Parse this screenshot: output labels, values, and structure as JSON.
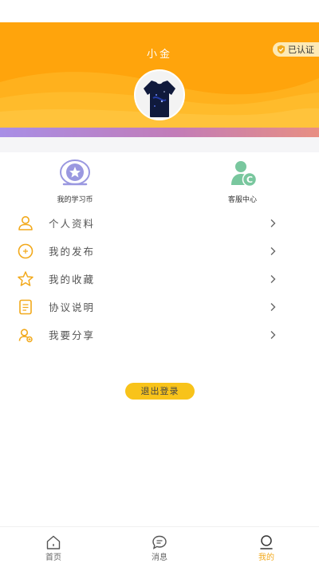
{
  "colors": {
    "accent": "#FFA70F",
    "tab_active": "#F2A91B",
    "logout_bg": "#F8C31A",
    "coin_icon": "#9a98e0",
    "service_icon": "#79c79e",
    "menu_icon": "#F2A91B"
  },
  "profile": {
    "username": "小金",
    "verified_label": "已认证"
  },
  "quick_actions": [
    {
      "label": "我的学习币",
      "icon": "star-coin-icon"
    },
    {
      "label": "客服中心",
      "icon": "customer-service-icon"
    }
  ],
  "menu": [
    {
      "label": "个人资料",
      "icon": "user-icon"
    },
    {
      "label": "我的发布",
      "icon": "plus-circle-icon"
    },
    {
      "label": "我的收藏",
      "icon": "star-icon"
    },
    {
      "label": "协议说明",
      "icon": "document-icon"
    },
    {
      "label": "我要分享",
      "icon": "share-user-icon"
    }
  ],
  "logout_label": "退出登录",
  "tabbar": [
    {
      "label": "首页",
      "icon": "home-icon",
      "active": false
    },
    {
      "label": "消息",
      "icon": "message-icon",
      "active": false
    },
    {
      "label": "我的",
      "icon": "profile-icon",
      "active": true
    }
  ]
}
